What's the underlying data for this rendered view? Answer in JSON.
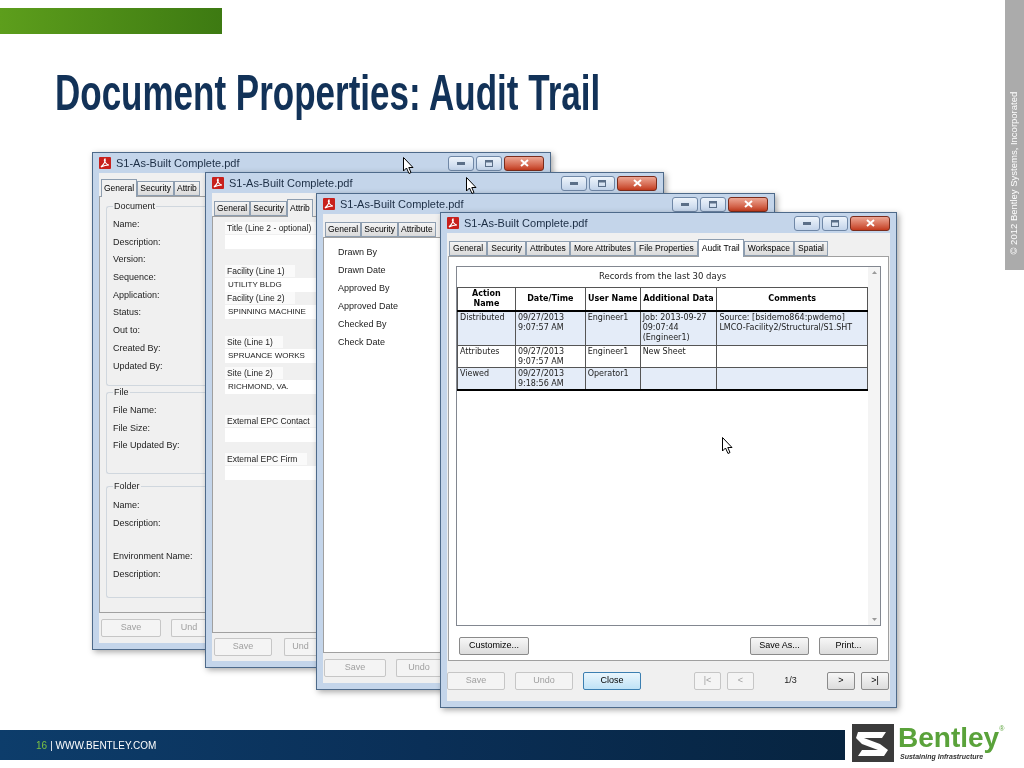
{
  "slide": {
    "title": "Document Properties: Audit Trail",
    "copyright": "© 2012 Bentley Systems, Incorporated"
  },
  "windows": [
    {
      "kind": "general",
      "title": "S1-As-Built Complete.pdf",
      "tabs": [
        {
          "label": "General",
          "selected": true
        },
        {
          "label": "Security",
          "selected": false
        },
        {
          "label": "Attrib",
          "selected": false
        }
      ],
      "groups": [
        {
          "title": "Document",
          "labels": [
            "Name:",
            "Description:",
            "Version:",
            "Sequence:",
            "Application:",
            "Status:",
            "Out to:",
            "Created By:",
            "Updated By:"
          ]
        },
        {
          "title": "File",
          "labels": [
            "File Name:",
            "File Size:",
            "File Updated By:"
          ]
        },
        {
          "title": "Folder",
          "labels": [
            "Name:",
            "Description:",
            "Environment Name:",
            "Description:"
          ]
        }
      ],
      "buttons": [
        {
          "label": "Save",
          "disabled": true
        },
        {
          "label": "Und",
          "disabled": true
        }
      ]
    },
    {
      "kind": "attributes",
      "title": "S1-As-Built Complete.pdf",
      "tabs": [
        {
          "label": "General",
          "selected": false
        },
        {
          "label": "Security",
          "selected": false
        },
        {
          "label": "Attrib",
          "selected": true
        }
      ],
      "fields": [
        {
          "label": "Title (Line 2 - optional)"
        },
        {
          "label": "Facility (Line 1)",
          "value": "UTILITY BLDG"
        },
        {
          "label": "Facility (Line 2)",
          "value": "SPINNING MACHINE"
        },
        {
          "label": "Site (Line 1)",
          "value": "SPRUANCE WORKS"
        },
        {
          "label": "Site (Line 2)",
          "value": "RICHMOND, VA."
        },
        {
          "label": "External EPC Contact"
        },
        {
          "label": "External EPC Firm"
        }
      ],
      "buttons": [
        {
          "label": "Save",
          "disabled": true
        },
        {
          "label": "Und",
          "disabled": true
        }
      ]
    },
    {
      "kind": "more_attributes",
      "title": "S1-As-Built Complete.pdf",
      "tabs": [
        {
          "label": "General",
          "selected": false
        },
        {
          "label": "Security",
          "selected": false
        },
        {
          "label": "Attribute",
          "selected": false
        }
      ],
      "labels": [
        "Drawn By",
        "Drawn Date",
        "Approved By",
        "Approved Date",
        "Checked By",
        "Check Date"
      ],
      "buttons": [
        {
          "label": "Save",
          "disabled": true
        },
        {
          "label": "Undo",
          "disabled": true
        }
      ]
    },
    {
      "kind": "audit_trail",
      "title": "S1-As-Built Complete.pdf",
      "tabs": [
        {
          "label": "General",
          "selected": false
        },
        {
          "label": "Security",
          "selected": false
        },
        {
          "label": "Attributes",
          "selected": false
        },
        {
          "label": "More Attributes",
          "selected": false
        },
        {
          "label": "File Properties",
          "selected": false
        },
        {
          "label": "Audit Trail",
          "selected": true
        },
        {
          "label": "Workspace",
          "selected": false
        },
        {
          "label": "Spatial",
          "selected": false
        }
      ],
      "table": {
        "caption": "Records from the last 30 days",
        "columns": [
          "Action Name",
          "Date/Time",
          "User Name",
          "Additional Data",
          "Comments"
        ],
        "rows": [
          [
            "Distributed",
            "09/27/2013 9:07:57 AM",
            "Engineer1",
            "Job: 2013-09-27 09:07:44 (Engineer1)",
            "Source: [bsidemo864:pwdemo] LMCO-Facility2/Structural/S1.SHT"
          ],
          [
            "Attributes",
            "09/27/2013 9:07:57 AM",
            "Engineer1",
            "New Sheet",
            ""
          ],
          [
            "Viewed",
            "09/27/2013 9:18:56 AM",
            "Operator1",
            "",
            ""
          ]
        ]
      },
      "actions": [
        {
          "label": "Customize..."
        },
        {
          "label": "Save As..."
        },
        {
          "label": "Print..."
        }
      ],
      "buttons": [
        {
          "label": "Save",
          "disabled": true
        },
        {
          "label": "Undo",
          "disabled": true
        },
        {
          "label": "Close",
          "disabled": false,
          "focused": true
        }
      ],
      "pager": {
        "back": [
          {
            "label": "|<",
            "disabled": true
          },
          {
            "label": "<",
            "disabled": true
          }
        ],
        "page": "1/3",
        "forward": [
          {
            "label": ">",
            "disabled": false
          },
          {
            "label": ">|",
            "disabled": false
          }
        ]
      }
    }
  ],
  "footer": {
    "page": "16",
    "site": "| WWW.BENTLEY.COM"
  },
  "logo": {
    "name": "Bentley",
    "mark": "®",
    "tagline": "Sustaining Infrastructure"
  }
}
